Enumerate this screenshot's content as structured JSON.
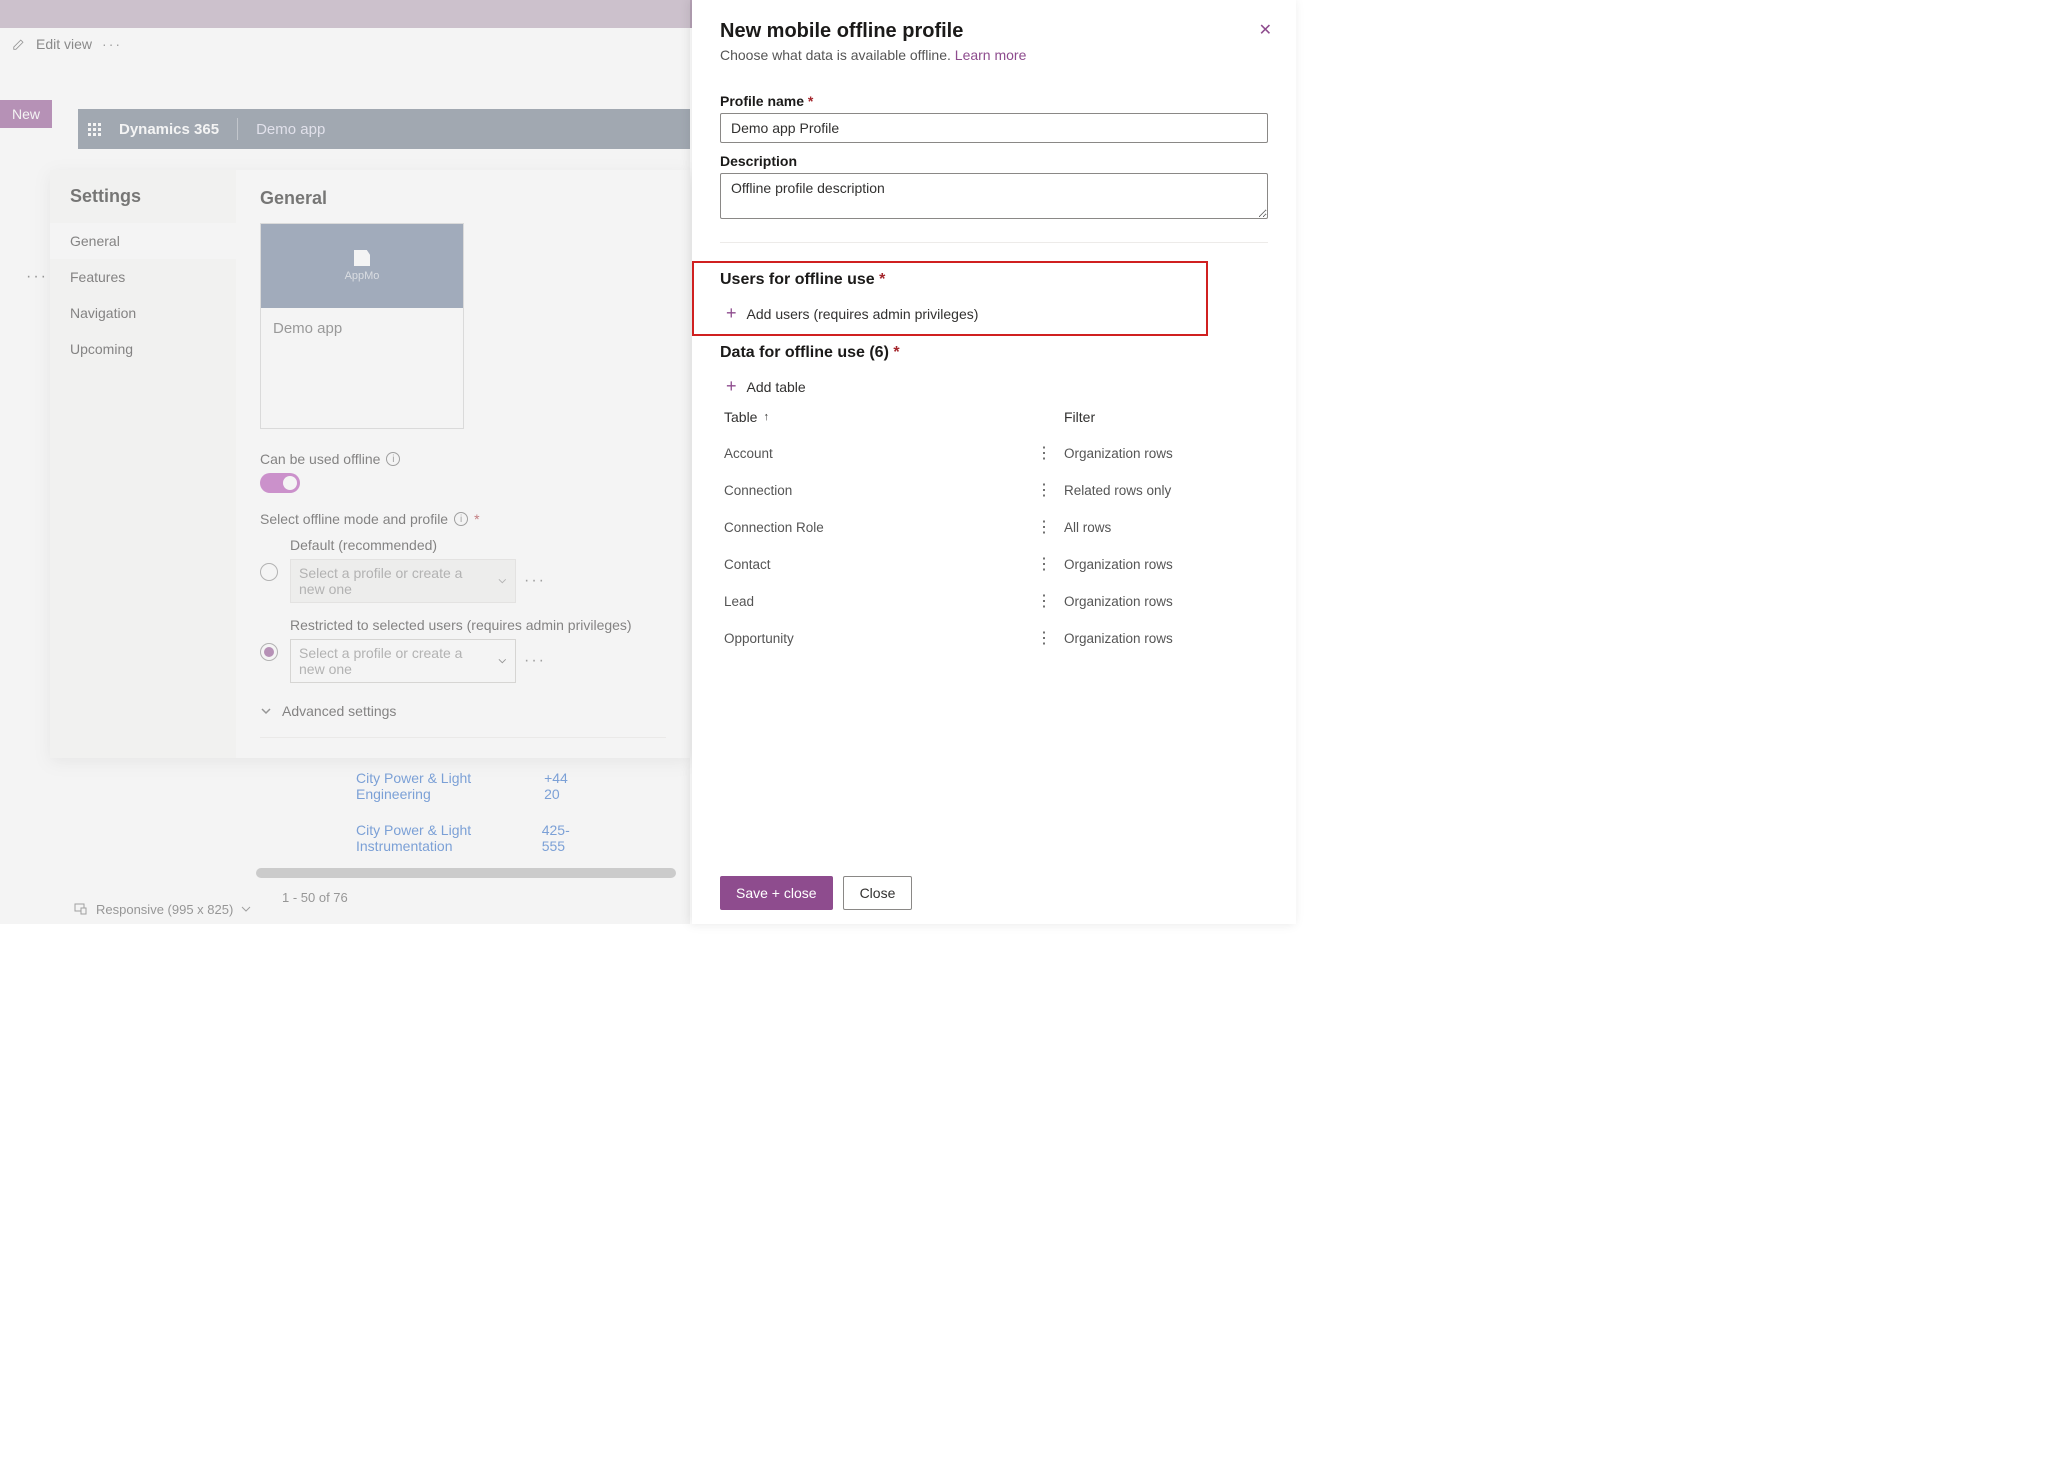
{
  "top": {
    "edit_view": "Edit view",
    "new_button": "New"
  },
  "dynamics": {
    "brand": "Dynamics 365",
    "app": "Demo app"
  },
  "settings": {
    "title": "Settings",
    "nav": {
      "general": "General",
      "features": "Features",
      "navigation": "Navigation",
      "upcoming": "Upcoming"
    },
    "content": {
      "heading": "General",
      "app_tile_label": "AppMo",
      "app_tile_name": "Demo app",
      "offline_label": "Can be used offline",
      "select_mode_label": "Select offline mode and profile",
      "option_default": "Default (recommended)",
      "option_restricted": "Restricted to selected users (requires admin privileges)",
      "select_placeholder": "Select a profile or create a new one",
      "advanced": "Advanced settings"
    }
  },
  "bg_rows": {
    "row1_name": "City Power & Light Engineering",
    "row1_phone": "+44 20",
    "row2_name": "City Power & Light Instrumentation",
    "row2_phone": "425-555",
    "pagination": "1 - 50 of 76"
  },
  "footer": {
    "responsive": "Responsive (995 x 825)"
  },
  "panel": {
    "title": "New mobile offline profile",
    "subtitle_text": "Choose what data is available offline.",
    "learn_more": "Learn more",
    "profile_name_label": "Profile name",
    "profile_name_value": "Demo app Profile",
    "description_label": "Description",
    "description_value": "Offline profile description",
    "users_heading": "Users for offline use",
    "add_users": "Add users (requires admin privileges)",
    "data_heading": "Data for offline use (6)",
    "add_table": "Add table",
    "col_table": "Table",
    "col_filter": "Filter",
    "rows": [
      {
        "name": "Account",
        "filter": "Organization rows"
      },
      {
        "name": "Connection",
        "filter": "Related rows only"
      },
      {
        "name": "Connection Role",
        "filter": "All rows"
      },
      {
        "name": "Contact",
        "filter": "Organization rows"
      },
      {
        "name": "Lead",
        "filter": "Organization rows"
      },
      {
        "name": "Opportunity",
        "filter": "Organization rows"
      }
    ],
    "save_close": "Save + close",
    "close": "Close"
  }
}
